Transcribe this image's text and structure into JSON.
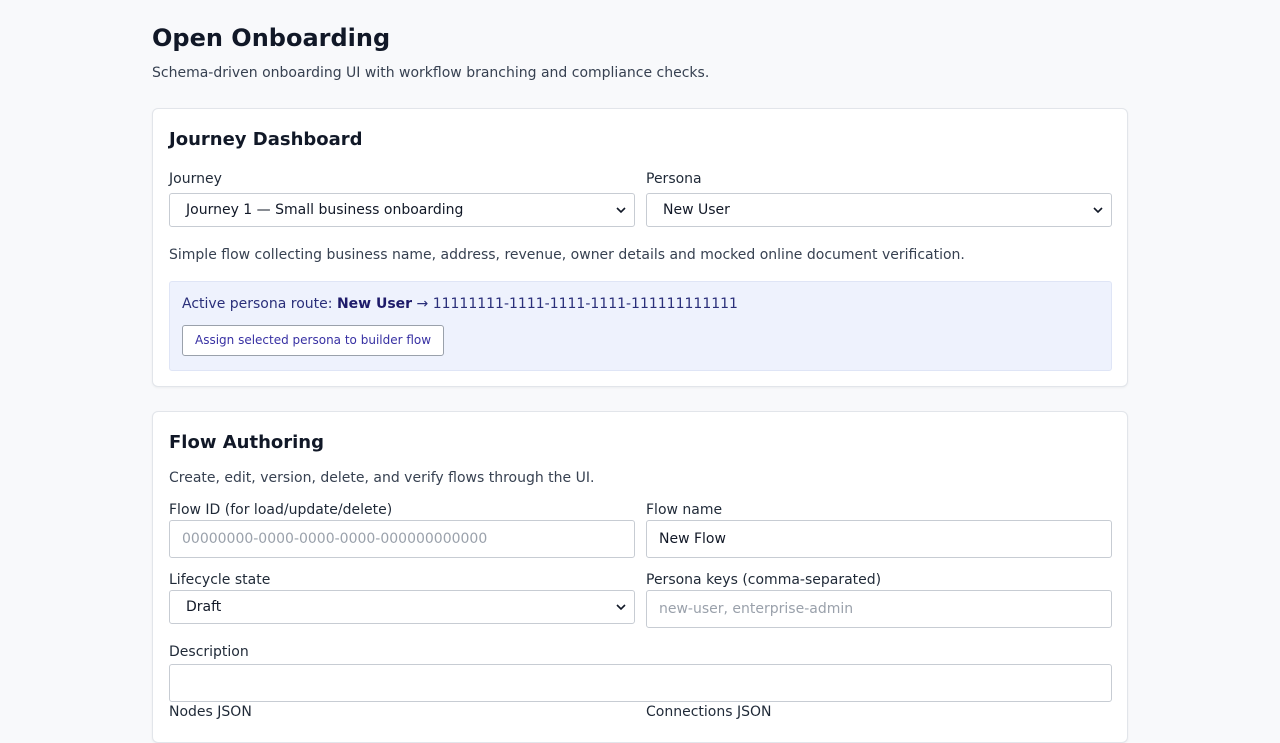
{
  "page": {
    "title": "Open Onboarding",
    "subtitle": "Schema-driven onboarding UI with workflow branching and compliance checks."
  },
  "dashboard": {
    "heading": "Journey Dashboard",
    "journey_label": "Journey",
    "journey_value": "Journey 1 — Small business onboarding",
    "persona_label": "Persona",
    "persona_value": "New User",
    "journey_description": "Simple flow collecting business name, address, revenue, owner details and mocked online document verification.",
    "route_prefix": "Active persona route:",
    "route_persona": "New User",
    "route_arrow": "→",
    "route_flow_id": "11111111-1111-1111-1111-111111111111",
    "assign_button": "Assign selected persona to builder flow"
  },
  "authoring": {
    "heading": "Flow Authoring",
    "description": "Create, edit, version, delete, and verify flows through the UI.",
    "flow_id_label": "Flow ID (for load/update/delete)",
    "flow_id_placeholder": "00000000-0000-0000-0000-000000000000",
    "flow_name_label": "Flow name",
    "flow_name_value": "New Flow",
    "lifecycle_label": "Lifecycle state",
    "lifecycle_value": "Draft",
    "persona_keys_label": "Persona keys (comma-separated)",
    "persona_keys_placeholder": "new-user, enterprise-admin",
    "description_label": "Description",
    "description_value": "",
    "nodes_label": "Nodes JSON",
    "connections_label": "Connections JSON"
  },
  "colors": {
    "accent": "#3730a3",
    "route_bg": "#eef2fd"
  }
}
